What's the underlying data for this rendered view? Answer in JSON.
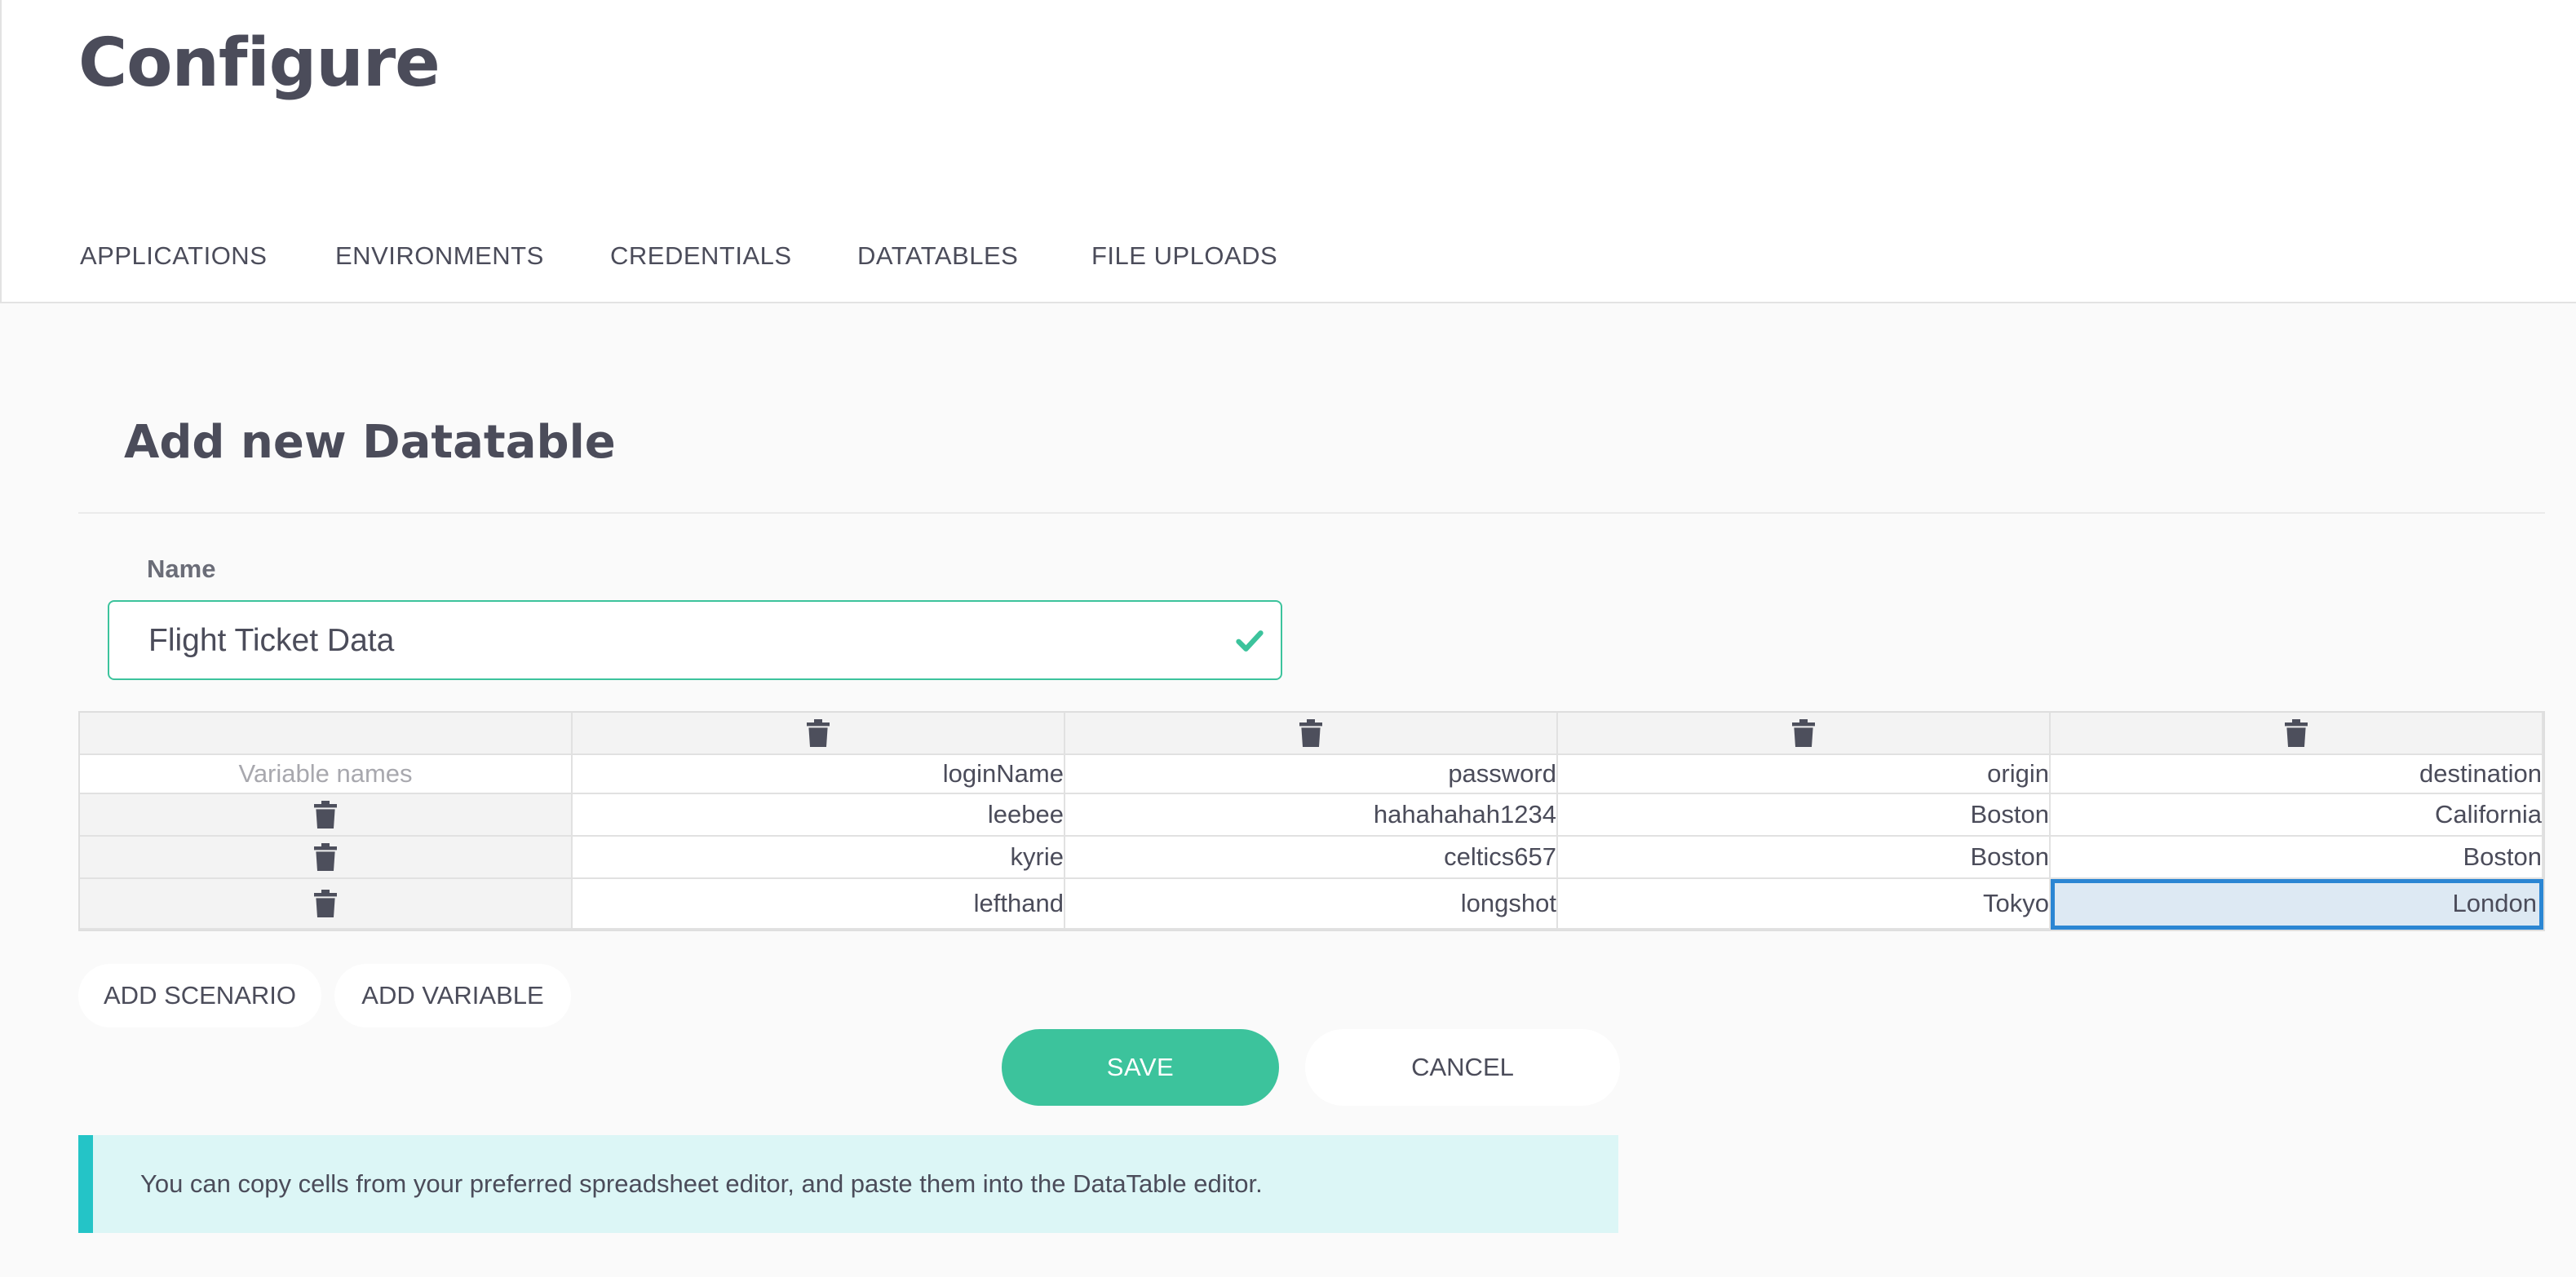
{
  "page": {
    "title": "Configure"
  },
  "tabs": [
    {
      "label": "APPLICATIONS"
    },
    {
      "label": "ENVIRONMENTS"
    },
    {
      "label": "CREDENTIALS"
    },
    {
      "label": "DATATABLES"
    },
    {
      "label": "FILE UPLOADS"
    }
  ],
  "form": {
    "section_title": "Add new Datatable",
    "name_label": "Name",
    "name_value": "Flight Ticket Data"
  },
  "table": {
    "row_header_label": "Variable names",
    "columns": [
      "loginName",
      "password",
      "origin",
      "destination"
    ],
    "rows": [
      [
        "leebee",
        "hahahahah1234",
        "Boston",
        "California"
      ],
      [
        "kyrie",
        "celtics657",
        "Boston",
        "Boston"
      ],
      [
        "lefthand",
        "longshot",
        "Tokyo",
        "London"
      ]
    ],
    "selected_cell": {
      "row": 2,
      "col": 3
    }
  },
  "actions": {
    "add_scenario": "ADD SCENARIO",
    "add_variable": "ADD VARIABLE",
    "save": "SAVE",
    "cancel": "CANCEL"
  },
  "info": {
    "message": "You can copy cells from your preferred spreadsheet editor, and paste them into the DataTable editor."
  },
  "colors": {
    "accent": "#3cc39c",
    "selection_border": "#2b86d3",
    "info_bar": "#24c4c7"
  }
}
